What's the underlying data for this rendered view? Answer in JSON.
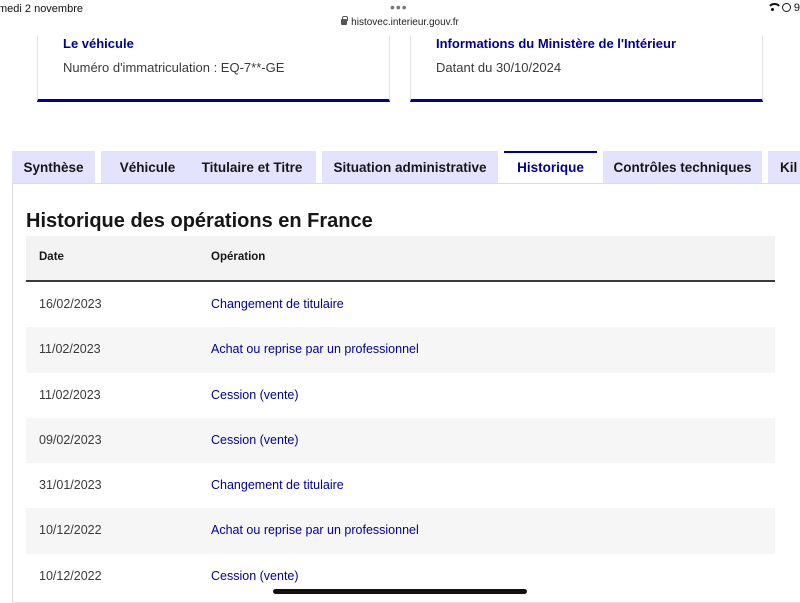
{
  "status_bar": {
    "time_date": "medi 2 novembre",
    "dots": "•••",
    "url": "histovec.interieur.gouv.fr",
    "battery": "9"
  },
  "cards": [
    {
      "title": "Le véhicule",
      "text": "Numéro d'immatriculation : EQ-7**-GE"
    },
    {
      "title": "Informations du Ministère de l'Intérieur",
      "text": "Datant du 30/10/2024"
    }
  ],
  "tabs": [
    {
      "label": "Synthèse",
      "active": false
    },
    {
      "label": "Véhicule",
      "active": false
    },
    {
      "label": "Titulaire et Titre",
      "active": false
    },
    {
      "label": "Situation administrative",
      "active": false
    },
    {
      "label": "Historique",
      "active": true
    },
    {
      "label": "Contrôles techniques",
      "active": false
    },
    {
      "label": "Kil",
      "active": false
    }
  ],
  "history": {
    "title": "Historique des opérations en France",
    "columns": [
      "Date",
      "Opération"
    ],
    "rows": [
      {
        "date": "16/02/2023",
        "operation": "Changement de titulaire"
      },
      {
        "date": "11/02/2023",
        "operation": "Achat ou reprise par un professionnel"
      },
      {
        "date": "11/02/2023",
        "operation": "Cession (vente)"
      },
      {
        "date": "09/02/2023",
        "operation": "Cession (vente)"
      },
      {
        "date": "31/01/2023",
        "operation": "Changement de titulaire"
      },
      {
        "date": "10/12/2022",
        "operation": "Achat ou reprise par un professionnel"
      },
      {
        "date": "10/12/2022",
        "operation": "Cession (vente)"
      }
    ]
  },
  "colors": {
    "primary": "#000091",
    "tab_bg": "#e3e3fd",
    "row_alt": "#f6f6f6"
  }
}
